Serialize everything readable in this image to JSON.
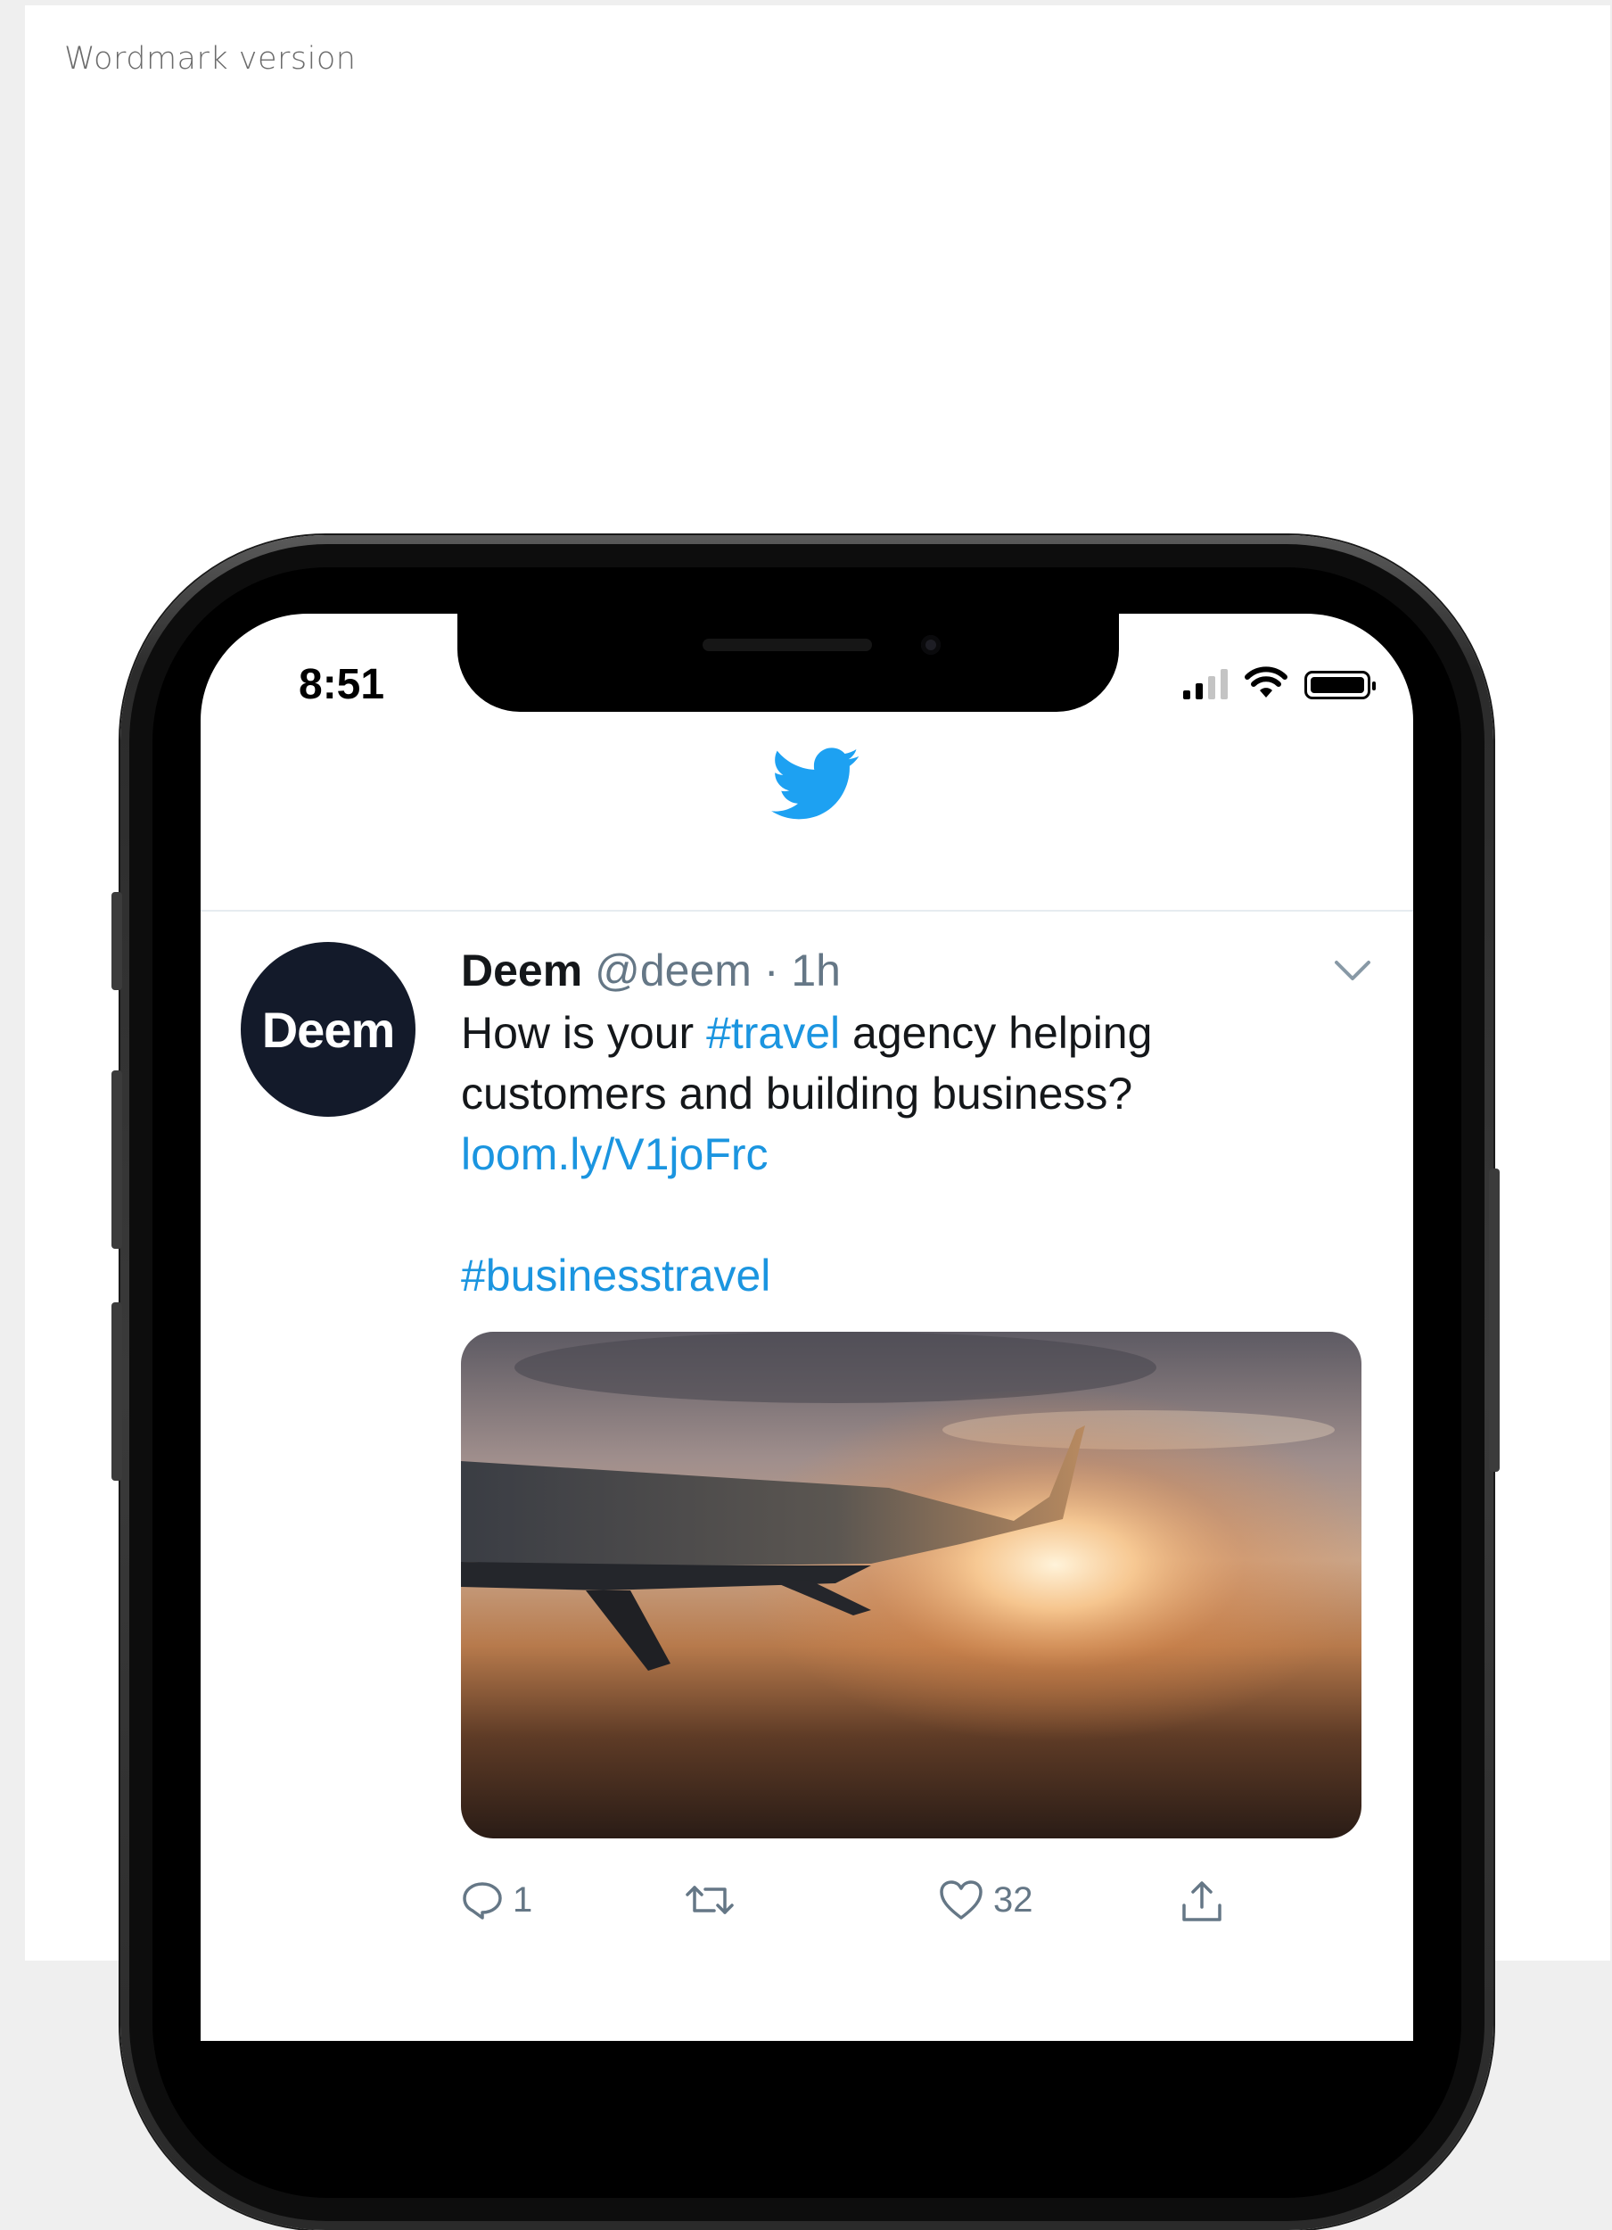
{
  "caption": "Wordmark version",
  "status_bar": {
    "time": "8:51"
  },
  "tweet": {
    "avatar_text": "Deem",
    "name": "Deem",
    "handle": "@deem",
    "separator": " · ",
    "age": "1h",
    "text_1": "How is your ",
    "hashtag_1": "#travel",
    "text_2": " agency helping customers and building business?",
    "link": "loom.ly/V1joFrc",
    "hashtag_2": "#businesstravel",
    "reply_count": "1",
    "like_count": "32"
  },
  "colors": {
    "twitter_blue": "#1da1f2",
    "link_blue": "#1b95e0",
    "avatar_bg": "#131a2a",
    "meta_gray": "#657786"
  },
  "icons": {
    "header": "twitter-bird-icon",
    "menu": "chevron-down-icon",
    "reply": "reply-icon",
    "retweet": "retweet-icon",
    "like": "heart-icon",
    "share": "share-icon"
  }
}
